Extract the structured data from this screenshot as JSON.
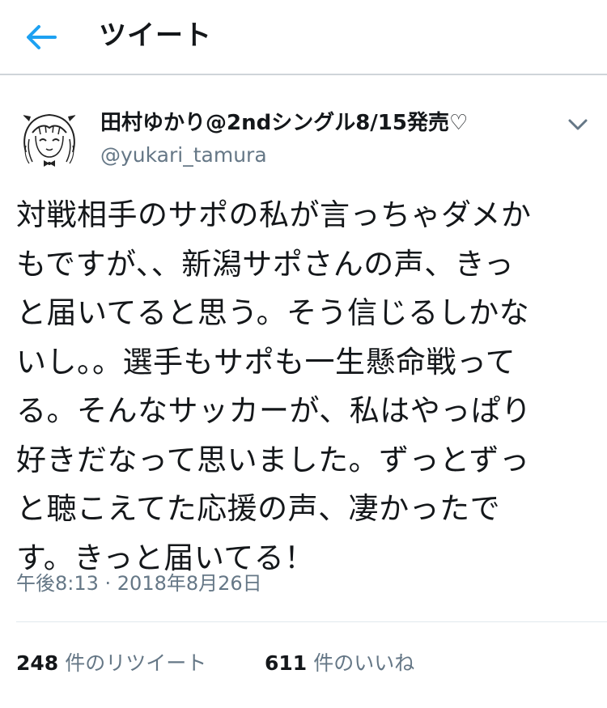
{
  "header": {
    "title": "ツイート",
    "back_icon": "back-arrow-icon",
    "accent_color": "#1da1f2"
  },
  "tweet": {
    "display_name": "田村ゆかり@2ndシングル8/15発売♡",
    "username": "@yukari_tamura",
    "text": "対戦相手のサポの私が言っちゃダメか\nもですが、、新潟サポさんの声、きっ\nと届いてると思う。そう信じるしかな\nいし。。選手もサポも一生懸命戦って\nる。そんなサッカーが、私はやっぱり\n好きだなって思いました。ずっとずっ\nと聴こえてた応援の声、凄かったで\nす。きっと届いてる！",
    "timestamp": "午後8:13 · 2018年8月26日",
    "menu_icon": "chevron-down-icon"
  },
  "stats": {
    "retweets": {
      "count": "248",
      "label": "件のリツイート"
    },
    "likes": {
      "count": "611",
      "label": "件のいいね"
    }
  }
}
